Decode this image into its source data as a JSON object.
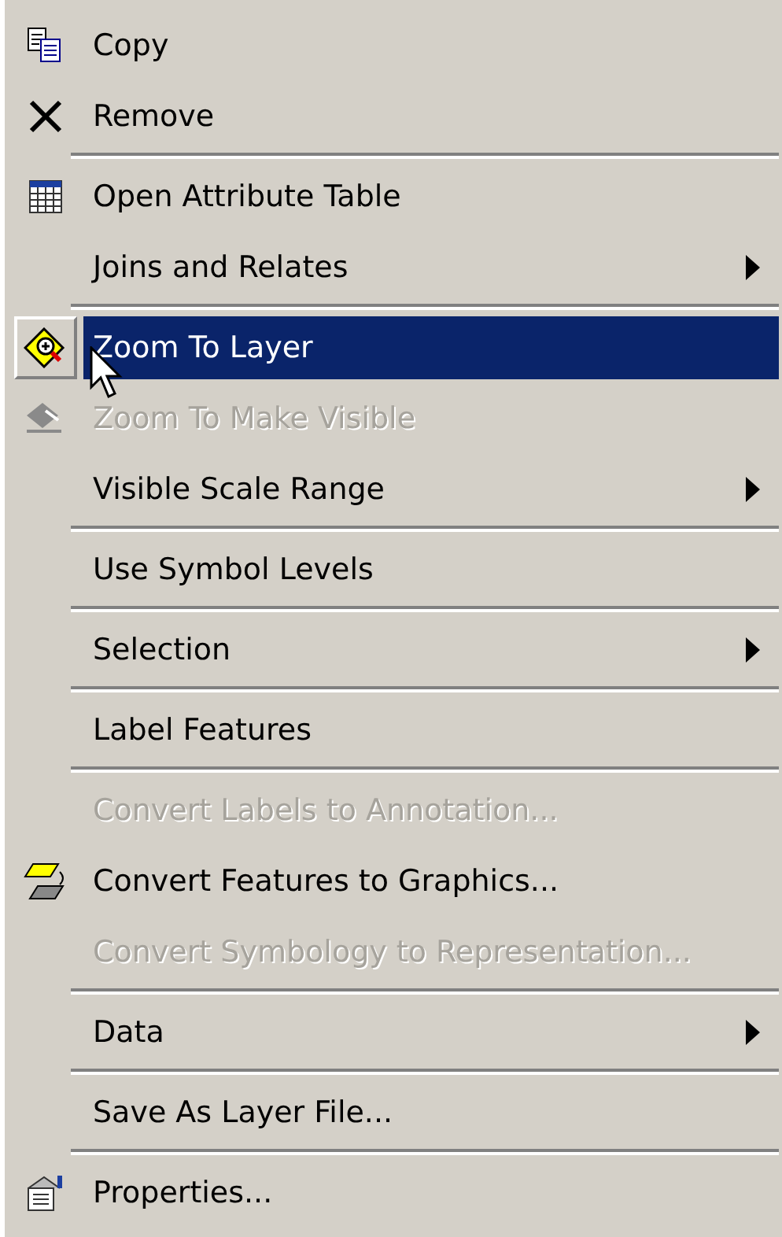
{
  "menu": {
    "items": [
      {
        "kind": "item",
        "label": "Copy",
        "disabled": false,
        "selected": false,
        "submenu": false
      },
      {
        "kind": "item",
        "label": "Remove",
        "disabled": false,
        "selected": false,
        "submenu": false
      },
      {
        "kind": "separator"
      },
      {
        "kind": "item",
        "label": "Open Attribute Table",
        "disabled": false,
        "selected": false,
        "submenu": false
      },
      {
        "kind": "item",
        "label": "Joins and Relates",
        "disabled": false,
        "selected": false,
        "submenu": true
      },
      {
        "kind": "separator"
      },
      {
        "kind": "item",
        "label": "Zoom To Layer",
        "disabled": false,
        "selected": true,
        "submenu": false
      },
      {
        "kind": "item",
        "label": "Zoom To Make Visible",
        "disabled": true,
        "selected": false,
        "submenu": false
      },
      {
        "kind": "item",
        "label": "Visible Scale Range",
        "disabled": false,
        "selected": false,
        "submenu": true
      },
      {
        "kind": "separator"
      },
      {
        "kind": "item",
        "label": "Use Symbol Levels",
        "disabled": false,
        "selected": false,
        "submenu": false
      },
      {
        "kind": "separator"
      },
      {
        "kind": "item",
        "label": "Selection",
        "disabled": false,
        "selected": false,
        "submenu": true
      },
      {
        "kind": "separator"
      },
      {
        "kind": "item",
        "label": "Label Features",
        "disabled": false,
        "selected": false,
        "submenu": false
      },
      {
        "kind": "separator"
      },
      {
        "kind": "item",
        "label": "Convert Labels to Annotation...",
        "disabled": true,
        "selected": false,
        "submenu": false
      },
      {
        "kind": "item",
        "label": "Convert Features to Graphics...",
        "disabled": false,
        "selected": false,
        "submenu": false
      },
      {
        "kind": "item",
        "label": "Convert Symbology to Representation...",
        "disabled": true,
        "selected": false,
        "submenu": false
      },
      {
        "kind": "separator"
      },
      {
        "kind": "item",
        "label": "Data",
        "disabled": false,
        "selected": false,
        "submenu": true
      },
      {
        "kind": "separator"
      },
      {
        "kind": "item",
        "label": "Save As Layer File...",
        "disabled": false,
        "selected": false,
        "submenu": false
      },
      {
        "kind": "separator"
      },
      {
        "kind": "item",
        "label": "Properties...",
        "disabled": false,
        "selected": false,
        "submenu": false
      }
    ]
  }
}
